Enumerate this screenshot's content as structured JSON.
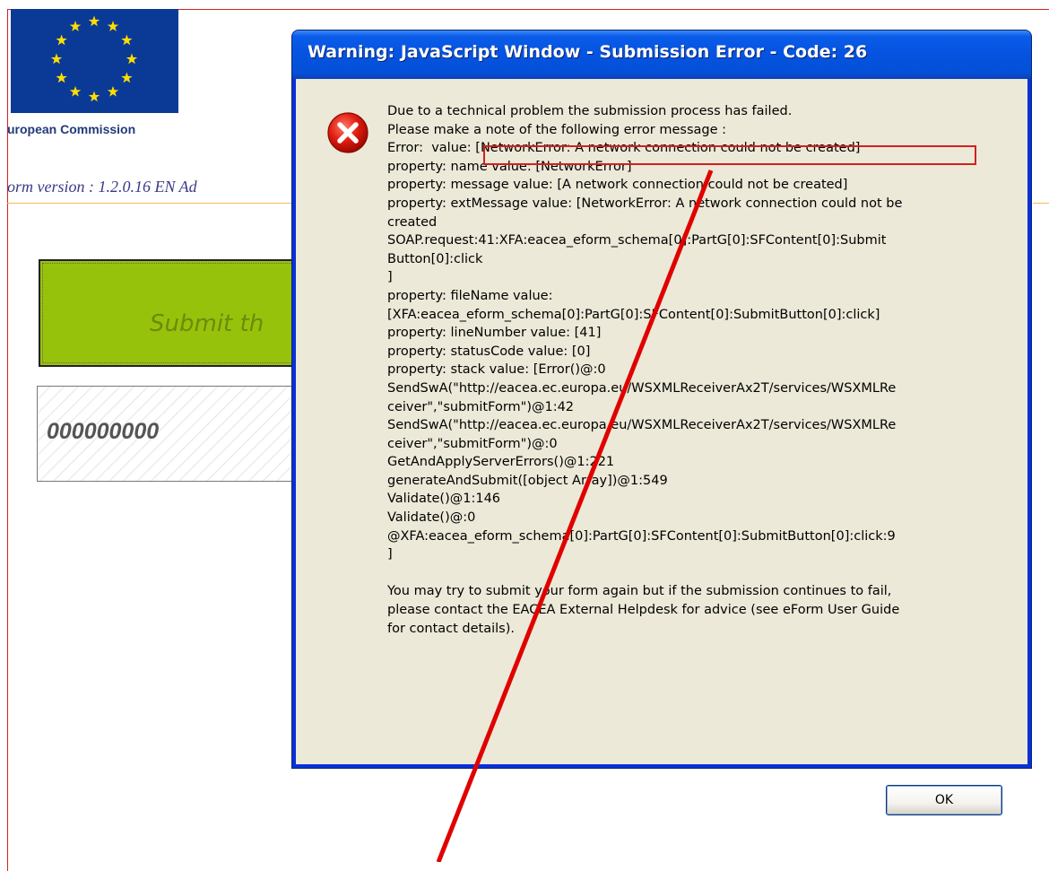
{
  "background_form": {
    "eu_caption": "uropean Commission",
    "form_version": "orm version : 1.2.0.16 EN  Ad",
    "submit_label": "Submit th",
    "number_value": "000000000"
  },
  "dialog": {
    "title": "Warning: JavaScript Window - Submission Error - Code: 26",
    "icon": "error-icon",
    "lines": [
      "Due to a technical problem the submission process has failed.",
      "Please make a note of the following error message :",
      "Error:  value: [NetworkError: A network connection could not be created]",
      "property: name value: [NetworkError]",
      "property: message value: [A network connection could not be created]",
      "property: extMessage value: [NetworkError: A network connection could not be",
      "created",
      "SOAP.request:41:XFA:eacea_eform_schema[0]:PartG[0]:SFContent[0]:Submit",
      "Button[0]:click",
      "]",
      "property: fileName value:",
      "[XFA:eacea_eform_schema[0]:PartG[0]:SFContent[0]:SubmitButton[0]:click]",
      "property: lineNumber value: [41]",
      "property: statusCode value: [0]",
      "property: stack value: [Error()@:0",
      "SendSwA(\"http://eacea.ec.europa.eu/WSXMLReceiverAx2T/services/WSXMLRe",
      "ceiver\",\"submitForm\")@1:42",
      "SendSwA(\"http://eacea.ec.europa.eu/WSXMLReceiverAx2T/services/WSXMLRe",
      "ceiver\",\"submitForm\")@:0",
      "GetAndApplyServerErrors()@1:221",
      "generateAndSubmit([object Array])@1:549",
      "Validate()@1:146",
      "Validate()@:0",
      "@XFA:eacea_eform_schema[0]:PartG[0]:SFContent[0]:SubmitButton[0]:click:9",
      "]",
      "",
      "You may try to submit your form again but if the submission continues to fail,",
      "please contact the EACEA External Helpdesk for advice (see eForm User Guide",
      "for contact details)."
    ],
    "ok_label": "OK"
  },
  "colors": {
    "annotation_red": "#e00000",
    "titlebar_blue": "#0553e0",
    "dialog_face": "#ece9d8",
    "submit_green": "#97c20c"
  }
}
